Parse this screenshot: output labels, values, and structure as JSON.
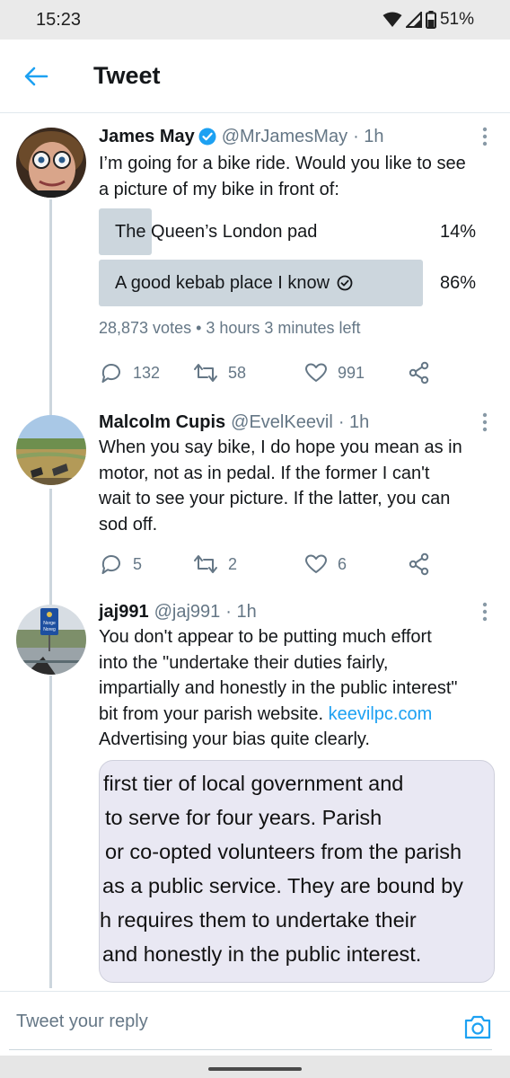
{
  "status_bar": {
    "time": "15:23",
    "battery": "51%"
  },
  "header": {
    "title": "Tweet"
  },
  "tweets": [
    {
      "name": "James May",
      "handle": "@MrJamesMay",
      "time": "· 1h",
      "text": [
        "I’m going for a bike ride. Would you like to see",
        "a picture of my bike in front of:"
      ],
      "poll": {
        "options": [
          {
            "label": "The Queen’s London pad",
            "percent": "14%",
            "value": 0.14,
            "selected": false
          },
          {
            "label": "A good kebab place I know",
            "percent": "86%",
            "value": 0.86,
            "selected": true
          }
        ],
        "meta": "28,873 votes • 3 hours 3 minutes left"
      },
      "counts": {
        "replies": "132",
        "retweets": "58",
        "likes": "991"
      }
    },
    {
      "name": "Malcolm Cupis",
      "handle": "@EvelKeevil",
      "time": "· 1h",
      "text": [
        "When you say bike, I do hope you mean as in",
        "motor, not as in pedal. If the former I can't",
        "wait to see your picture. If the latter, you can",
        "sod off."
      ],
      "counts": {
        "replies": "5",
        "retweets": "2",
        "likes": "6"
      }
    },
    {
      "name": "jaj991",
      "handle": "@jaj991",
      "time": "· 1h",
      "text": [
        "You don't appear to be putting much effort",
        "into the \"undertake their duties fairly,",
        "impartially and honestly in the public interest\"",
        "bit from your parish website."
      ],
      "link": "keevilpc.com",
      "text_tail": "Advertising your bias quite clearly.",
      "avatar_sign": [
        "Norge",
        "Noreg"
      ],
      "image_text": [
        "first tier of local government and",
        "to serve for four years. Parish",
        "or co-opted volunteers from the parish",
        "as a public service. They are bound by",
        "h requires them to undertake their",
        "and honestly in the public interest."
      ]
    }
  ],
  "reply": {
    "placeholder": "Tweet your reply"
  },
  "colors": {
    "accent": "#1da1f2",
    "secondary_text": "#657786",
    "poll_fill": "#ccd6dd",
    "divider": "#e1e8ed"
  }
}
